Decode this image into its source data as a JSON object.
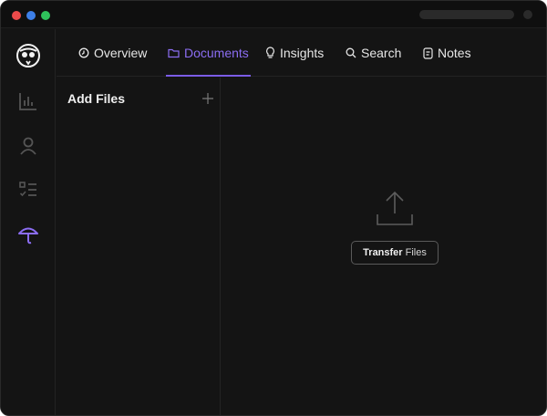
{
  "window": {
    "traffic_lights": [
      "red",
      "blue",
      "green"
    ],
    "colors": {
      "red": "#ec4a4a",
      "blue": "#3d7fe8",
      "green": "#2fc25b",
      "accent": "#8b6df2"
    }
  },
  "sidebar": {
    "items": [
      {
        "icon": "owl-logo-icon",
        "active": false
      },
      {
        "icon": "bar-chart-icon",
        "active": false
      },
      {
        "icon": "user-icon",
        "active": false
      },
      {
        "icon": "checklist-icon",
        "active": false
      },
      {
        "icon": "umbrella-icon",
        "active": true
      }
    ]
  },
  "nav": {
    "tabs": [
      {
        "label": "Overview",
        "icon": "clock-icon",
        "active": false
      },
      {
        "label": "Documents",
        "icon": "folder-icon",
        "active": true
      },
      {
        "label": "Insights",
        "icon": "lightbulb-icon",
        "active": false
      },
      {
        "label": "Search",
        "icon": "search-icon",
        "active": false
      },
      {
        "label": "Notes",
        "icon": "note-icon",
        "active": false
      }
    ]
  },
  "panel": {
    "title": "Add Files",
    "add_icon": "plus-icon"
  },
  "main": {
    "upload_icon": "upload-icon",
    "button_bold": "Transfer",
    "button_rest": "Files"
  }
}
